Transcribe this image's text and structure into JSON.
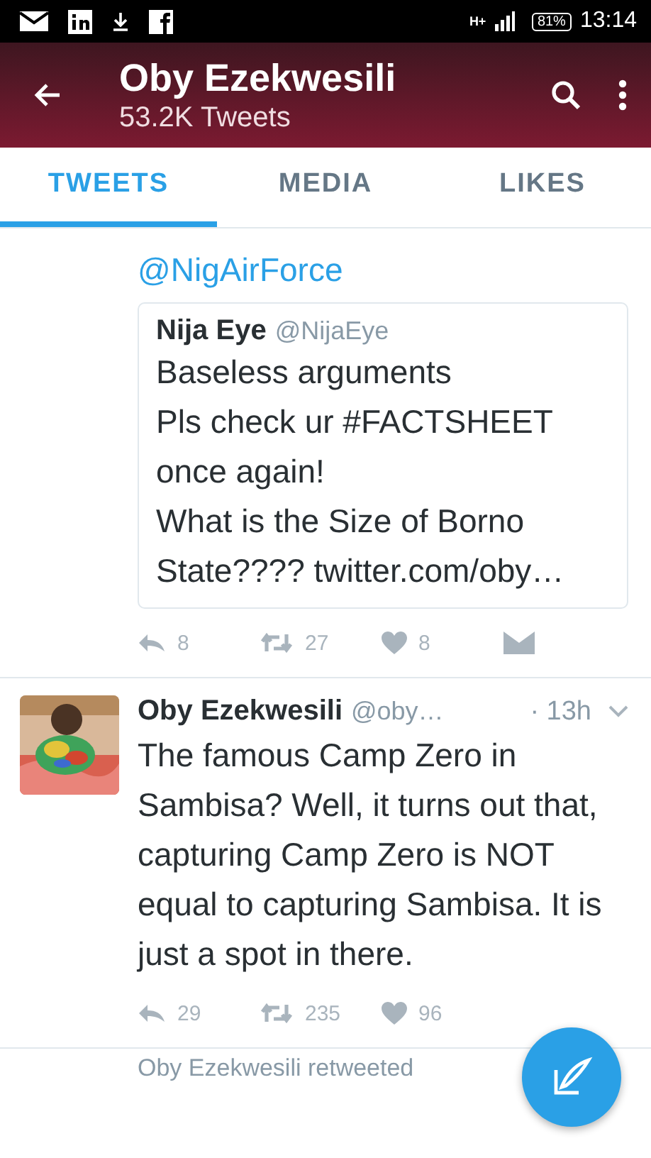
{
  "status_bar": {
    "network": "H+",
    "battery": "81%",
    "time": "13:14"
  },
  "header": {
    "title": "Oby Ezekwesili",
    "subtitle": "53.2K Tweets"
  },
  "tabs": [
    {
      "label": "TWEETS",
      "selected": true
    },
    {
      "label": "MEDIA",
      "selected": false
    },
    {
      "label": "LIKES",
      "selected": false
    }
  ],
  "tweets": [
    {
      "kind": "continuation",
      "mention": "@NigAirForce",
      "quote": {
        "name": "Nija Eye",
        "handle": "@NijaEye",
        "text": "Baseless arguments\nPls check ur #FACTSHEET once again!\nWhat is the Size of Borno State???? twitter.com/oby…"
      },
      "actions": [
        {
          "kind": "reply",
          "count": "8"
        },
        {
          "kind": "retweet",
          "count": "27"
        },
        {
          "kind": "like",
          "count": "8"
        },
        {
          "kind": "message"
        }
      ]
    },
    {
      "kind": "tweet",
      "name": "Oby Ezekwesili",
      "handle": "@oby…",
      "time": "· 13h",
      "text": "The famous Camp Zero in Sambisa? Well, it turns out that, capturing Camp Zero is NOT equal to capturing Sambisa. It is just a spot in there.",
      "actions": [
        {
          "kind": "reply",
          "count": "29"
        },
        {
          "kind": "retweet",
          "count": "235"
        },
        {
          "kind": "like",
          "count": "96"
        }
      ]
    }
  ],
  "retweet_notice": "Oby Ezekwesili retweeted"
}
